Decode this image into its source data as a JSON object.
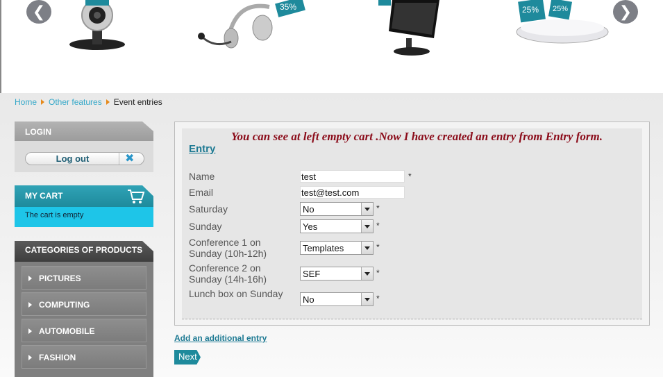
{
  "breadcrumb": {
    "home": "Home",
    "other": "Other features",
    "current": "Event entries"
  },
  "login": {
    "title": "LOGIN",
    "logout_label": "Log out",
    "close_icon": "close-icon"
  },
  "cart": {
    "title": "MY CART",
    "icon": "cart-icon",
    "empty_text": "The cart is empty"
  },
  "categories": {
    "title": "CATEGORIES OF PRODUCTS",
    "items": [
      "PICTURES",
      "COMPUTING",
      "AUTOMOBILE",
      "FASHION"
    ]
  },
  "banner": {
    "prev_icon": "chevron-left-icon",
    "next_icon": "chevron-right-icon",
    "prev_glyph": "❮",
    "next_glyph": "❯",
    "badges": [
      "35%",
      "25%",
      "25%"
    ]
  },
  "form": {
    "title": "Entry",
    "note": "You can see at left empty cart .Now I have created an entry from Entry form.",
    "fields": {
      "name": {
        "label": "Name",
        "value": "test",
        "required": "*"
      },
      "email": {
        "label": "Email",
        "value": "test@test.com"
      },
      "saturday": {
        "label": "Saturday",
        "value": "No",
        "required": "*"
      },
      "sunday": {
        "label": "Sunday",
        "value": "Yes",
        "required": "*"
      },
      "conf1": {
        "label": "Conference 1 on Sunday (10h-12h)",
        "value": "Templates",
        "required": "*"
      },
      "conf2": {
        "label": "Conference 2 on Sunday (14h-16h)",
        "value": "SEF",
        "required": "*"
      },
      "lunch": {
        "label": "Lunch box on Sunday",
        "value": "No",
        "required": "*"
      }
    },
    "add_entry": "Add an additional entry",
    "next": "Next"
  },
  "colors": {
    "accent": "#1e8a9c",
    "link": "#35a8c9",
    "note": "#8b0c1a",
    "cart_body": "#1ec5e8"
  }
}
